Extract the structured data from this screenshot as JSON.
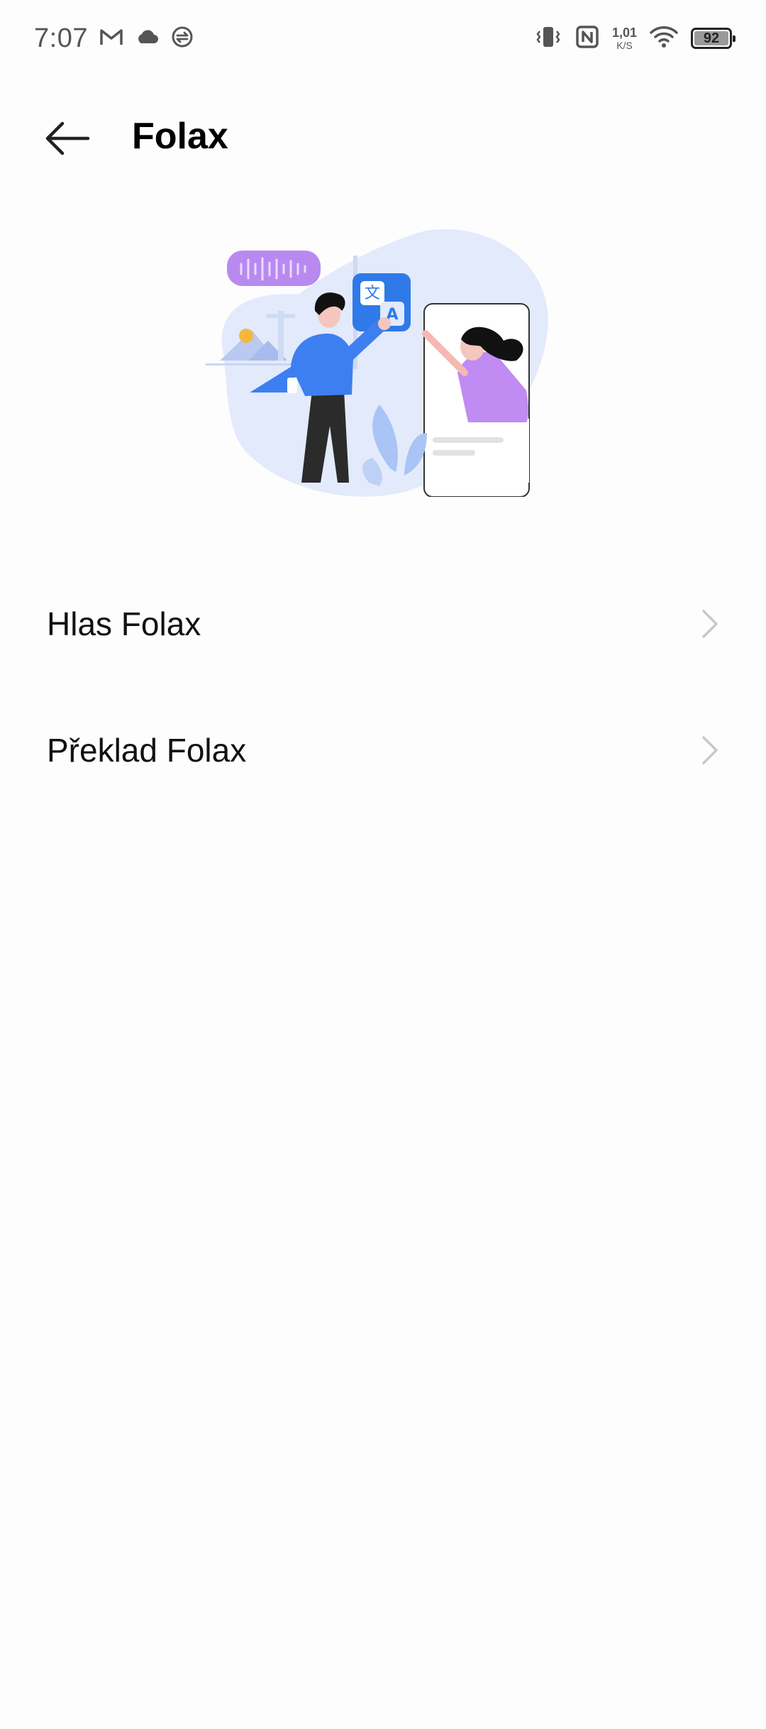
{
  "status_bar": {
    "time": "7:07",
    "net_speed_value": "1,01",
    "net_speed_unit": "K/S",
    "battery_level": "92",
    "icons": [
      "gmail-icon",
      "cloud-icon",
      "sync-icon",
      "vibrate-icon",
      "nfc-icon",
      "wifi-icon",
      "battery-icon"
    ]
  },
  "header": {
    "title": "Folax",
    "back_icon": "arrow-left-icon"
  },
  "illustration": {
    "icon": "translate-icon",
    "colors": {
      "accent_blue": "#2f7ae8",
      "accent_purple": "#b88af0",
      "bg_blue": "#e3eafb"
    }
  },
  "list": {
    "items": [
      {
        "label": "Hlas Folax",
        "icon": "chevron-right-icon"
      },
      {
        "label": "Překlad Folax",
        "icon": "chevron-right-icon"
      }
    ]
  }
}
